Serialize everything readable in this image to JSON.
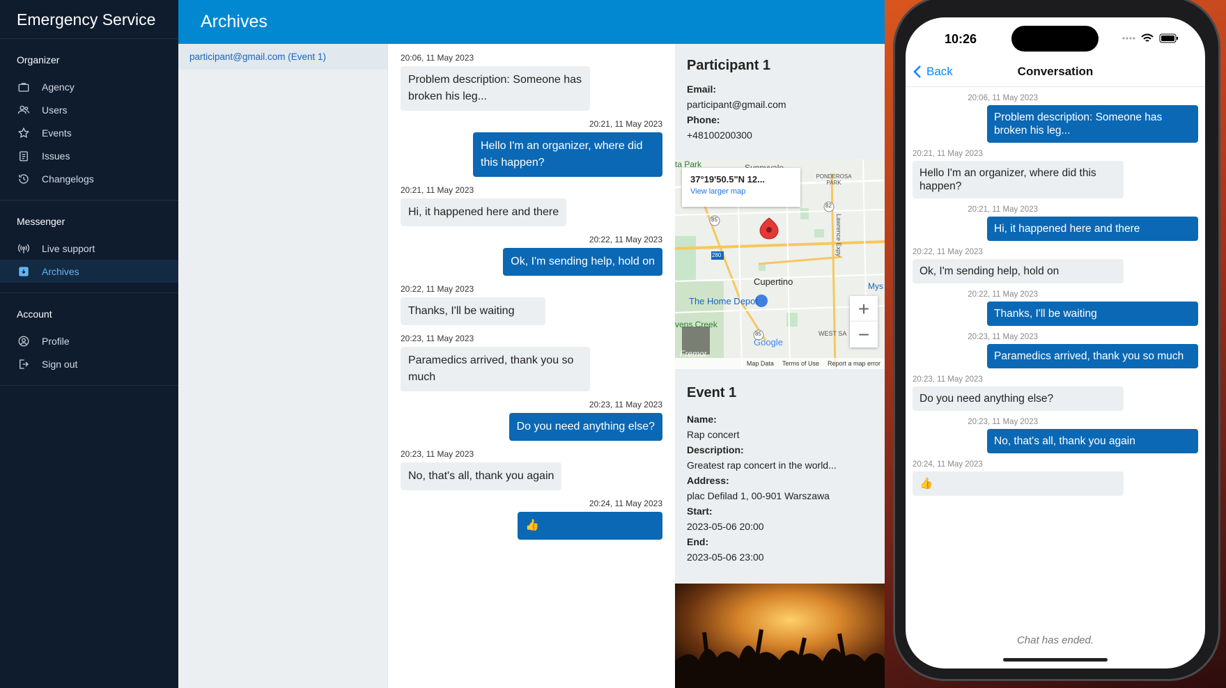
{
  "app": {
    "title": "Emergency Service"
  },
  "sidebar": {
    "sections": [
      {
        "title": "Organizer",
        "items": [
          {
            "label": "Agency",
            "icon": "briefcase-icon"
          },
          {
            "label": "Users",
            "icon": "users-icon"
          },
          {
            "label": "Events",
            "icon": "star-icon"
          },
          {
            "label": "Issues",
            "icon": "clipboard-icon"
          },
          {
            "label": "Changelogs",
            "icon": "history-icon"
          }
        ]
      },
      {
        "title": "Messenger",
        "items": [
          {
            "label": "Live support",
            "icon": "broadcast-icon"
          },
          {
            "label": "Archives",
            "icon": "archive-icon",
            "active": true
          }
        ]
      },
      {
        "title": "Account",
        "items": [
          {
            "label": "Profile",
            "icon": "account-circle-icon"
          },
          {
            "label": "Sign out",
            "icon": "logout-icon"
          }
        ]
      }
    ]
  },
  "header": {
    "title": "Archives"
  },
  "conversations": [
    {
      "label": "participant@gmail.com (Event 1)"
    }
  ],
  "chat": {
    "messages": [
      {
        "dir": "in",
        "time": "20:06, 11 May 2023",
        "text": "Problem description: Someone has broken his leg..."
      },
      {
        "dir": "out",
        "time": "20:21, 11 May 2023",
        "text": "Hello I'm an organizer, where did this happen?"
      },
      {
        "dir": "in",
        "time": "20:21, 11 May 2023",
        "text": "Hi, it happened here and there"
      },
      {
        "dir": "out",
        "time": "20:22, 11 May 2023",
        "text": "Ok, I'm sending help, hold on"
      },
      {
        "dir": "in",
        "time": "20:22, 11 May 2023",
        "text": "Thanks, I'll be waiting"
      },
      {
        "dir": "in",
        "time": "20:23, 11 May 2023",
        "text": "Paramedics arrived, thank you so much"
      },
      {
        "dir": "out",
        "time": "20:23, 11 May 2023",
        "text": "Do you need anything else?"
      },
      {
        "dir": "in",
        "time": "20:23, 11 May 2023",
        "text": "No, that's all, thank you again"
      },
      {
        "dir": "out",
        "time": "20:24, 11 May 2023",
        "text": "👍"
      }
    ]
  },
  "participant": {
    "title": "Participant 1",
    "email_label": "Email:",
    "email": "participant@gmail.com",
    "phone_label": "Phone:",
    "phone": "+48100200300"
  },
  "map": {
    "coords": "37°19'50.5\"N 12...",
    "larger_link": "View larger map",
    "labels": {
      "park": "ta Park",
      "sunnyvale": "Sunnyvale",
      "ponderosa": "PONDEROSA PARK",
      "cupertino": "Cupertino",
      "home_depot": "The Home Depot",
      "stevens_creek": "vens Creek",
      "west_san": "WEST SA",
      "lawrence": "Lawrence Expy",
      "mys": "Mys",
      "fremont": "Fremor",
      "google": "Google",
      "route_85a": "85",
      "route_85b": "85",
      "route_280": "280",
      "route_82": "82"
    },
    "zoom_in": "+",
    "zoom_out": "−",
    "attribution": {
      "data": "Map Data",
      "terms": "Terms of Use",
      "report": "Report a map error"
    }
  },
  "event": {
    "title": "Event 1",
    "name_label": "Name:",
    "name": "Rap concert",
    "description_label": "Description:",
    "description": "Greatest rap concert in the world...",
    "address_label": "Address:",
    "address": "plac Defilad 1, 00-901 Warszawa",
    "start_label": "Start:",
    "start": "2023-05-06 20:00",
    "end_label": "End:",
    "end": "2023-05-06 23:00"
  },
  "phone": {
    "clock": "10:26",
    "back_label": "Back",
    "nav_title": "Conversation",
    "ended": "Chat has ended.",
    "messages": [
      {
        "dir": "out",
        "time": "20:06, 11 May 2023",
        "text": "Problem description: Someone has broken his leg..."
      },
      {
        "dir": "in",
        "time": "20:21, 11 May 2023",
        "text": "Hello I'm an organizer, where did this happen?"
      },
      {
        "dir": "out",
        "time": "20:21, 11 May 2023",
        "text": "Hi, it happened here and there"
      },
      {
        "dir": "in",
        "time": "20:22, 11 May 2023",
        "text": "Ok, I'm sending help, hold on"
      },
      {
        "dir": "out",
        "time": "20:22, 11 May 2023",
        "text": "Thanks, I'll be waiting"
      },
      {
        "dir": "out",
        "time": "20:23, 11 May 2023",
        "text": "Paramedics arrived, thank you so much"
      },
      {
        "dir": "in",
        "time": "20:23, 11 May 2023",
        "text": "Do you need anything else?"
      },
      {
        "dir": "out",
        "time": "20:23, 11 May 2023",
        "text": "No, that's all, thank you again"
      },
      {
        "dir": "in",
        "time": "20:24, 11 May 2023",
        "text": "👍"
      }
    ]
  },
  "colors": {
    "sidebar_bg": "#0f1c2e",
    "topbar_bg": "#0288d1",
    "bubble_out": "#0b68b4",
    "bubble_in": "#eceff1",
    "active_nav": "#64b5f6",
    "map_pin": "#e53935"
  }
}
